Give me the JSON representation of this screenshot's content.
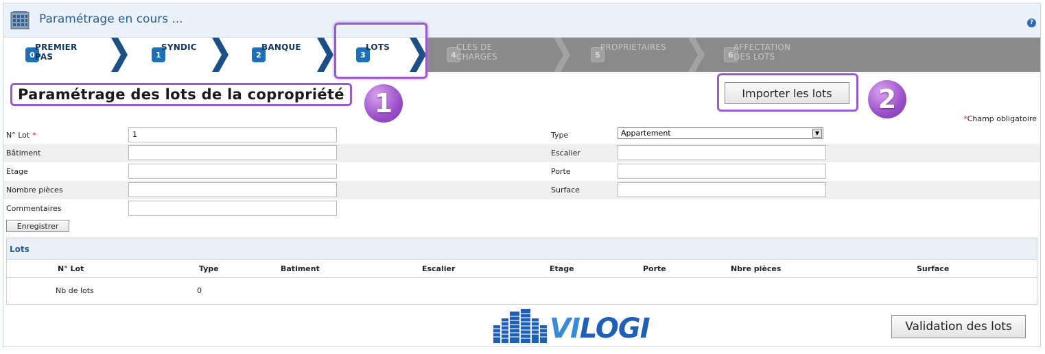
{
  "header": {
    "title": "Paramétrage en cours ...",
    "help": "?"
  },
  "steps": [
    {
      "num": "0",
      "label": "PREMIER PAS",
      "enabled": true
    },
    {
      "num": "1",
      "label": "SYNDIC",
      "enabled": true
    },
    {
      "num": "2",
      "label": "BANQUE",
      "enabled": true
    },
    {
      "num": "3",
      "label": "LOTS",
      "enabled": true
    },
    {
      "num": "4",
      "label": "CLÉS DE CHARGES",
      "enabled": false
    },
    {
      "num": "5",
      "label": "PROPRIÉTAIRES",
      "enabled": false
    },
    {
      "num": "6",
      "label": "AFFECTATION DES LOTS",
      "enabled": false
    }
  ],
  "page": {
    "title": "Paramétrage des lots de la copropriété",
    "badge1": "1",
    "badge2": "2",
    "import_label": "Importer les lots",
    "required_note": "Champ obligatoire",
    "required_star": "*"
  },
  "form": {
    "lot_label": "N° Lot",
    "lot_value": "1",
    "type_label": "Type",
    "type_value": "Appartement",
    "batiment_label": "Bâtiment",
    "escalier_label": "Escalier",
    "etage_label": "Etage",
    "porte_label": "Porte",
    "pieces_label": "Nombre pièces",
    "surface_label": "Surface",
    "commentaires_label": "Commentaires",
    "save_label": "Enregistrer"
  },
  "lots": {
    "title": "Lots",
    "columns": [
      "N° Lot",
      "Type",
      "Batiment",
      "Escalier",
      "Etage",
      "Porte",
      "Nbre pièces",
      "Surface"
    ],
    "summary_label": "Nb de lots",
    "summary_value": "0"
  },
  "footer": {
    "logo_vi": "VI",
    "logo_logi": "LOGI",
    "validate_label": "Validation des lots"
  },
  "colors": {
    "accent": "#1f6fb8",
    "highlight": "#9b59d0",
    "stepbar_disabled": "#8a8a8a"
  }
}
